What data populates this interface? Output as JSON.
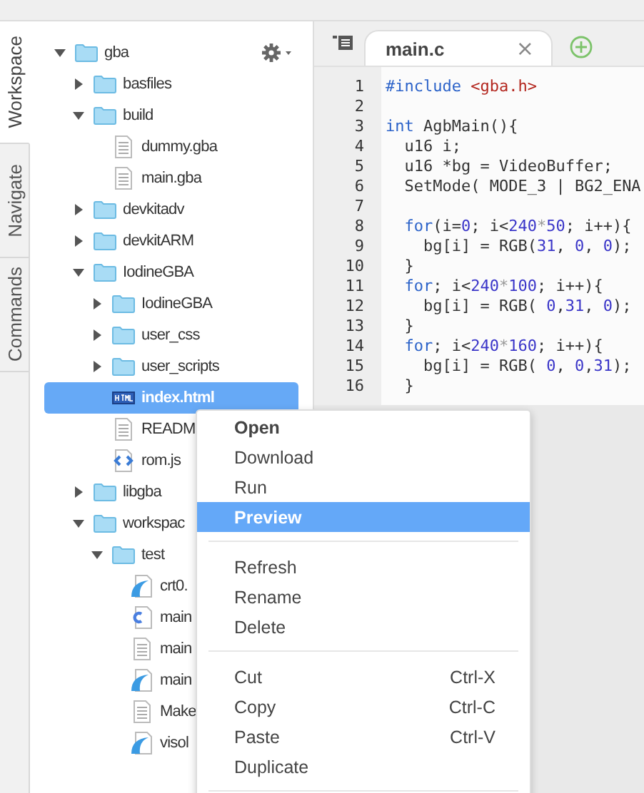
{
  "side_tabs": [
    {
      "label": "Workspace",
      "selected": true
    },
    {
      "label": "Navigate",
      "selected": false
    },
    {
      "label": "Commands",
      "selected": false
    }
  ],
  "tree": [
    {
      "name": "gba",
      "kind": "folder",
      "expanded": true,
      "selected": false,
      "children": [
        {
          "name": "basfiles",
          "kind": "folder",
          "expanded": false,
          "selected": false
        },
        {
          "name": "build",
          "kind": "folder",
          "expanded": true,
          "selected": false,
          "children": [
            {
              "name": "dummy.gba",
              "kind": "file",
              "selected": false
            },
            {
              "name": "main.gba",
              "kind": "file",
              "selected": false
            }
          ]
        },
        {
          "name": "devkitadv",
          "kind": "folder",
          "expanded": false,
          "selected": false
        },
        {
          "name": "devkitARM",
          "kind": "folder",
          "expanded": false,
          "selected": false
        },
        {
          "name": "IodineGBA",
          "kind": "folder",
          "expanded": true,
          "selected": false,
          "children": [
            {
              "name": "IodineGBA",
              "kind": "folder",
              "expanded": false,
              "selected": false
            },
            {
              "name": "user_css",
              "kind": "folder",
              "expanded": false,
              "selected": false
            },
            {
              "name": "user_scripts",
              "kind": "folder",
              "expanded": false,
              "selected": false
            },
            {
              "name": "index.html",
              "kind": "html",
              "selected": true
            },
            {
              "name": "READM",
              "kind": "file",
              "selected": false
            },
            {
              "name": "rom.js",
              "kind": "json",
              "selected": false
            }
          ]
        },
        {
          "name": "libgba",
          "kind": "folder",
          "expanded": false,
          "selected": false
        },
        {
          "name": "workspac",
          "kind": "folder",
          "expanded": true,
          "selected": false,
          "children": [
            {
              "name": "test",
              "kind": "folder",
              "expanded": true,
              "selected": false,
              "children": [
                {
                  "name": "crt0.",
                  "kind": "asm",
                  "selected": false
                },
                {
                  "name": "main",
                  "kind": "c",
                  "selected": false
                },
                {
                  "name": "main",
                  "kind": "file",
                  "selected": false
                },
                {
                  "name": "main",
                  "kind": "asm",
                  "selected": false
                },
                {
                  "name": "Make",
                  "kind": "file",
                  "selected": false
                },
                {
                  "name": "visol",
                  "kind": "asm",
                  "selected": false
                }
              ]
            }
          ]
        }
      ]
    }
  ],
  "editor": {
    "tab": {
      "title": "main.c",
      "close": "×"
    },
    "lines": [
      {
        "n": "1",
        "tokens": [
          {
            "kind": "kw",
            "t": "#include "
          },
          {
            "kind": "str",
            "t": "<gba.h>"
          }
        ]
      },
      {
        "n": "2"
      },
      {
        "n": "3",
        "tokens": [
          {
            "kind": "kw",
            "t": "int"
          },
          {
            "kind": "plain",
            "t": " AgbMain(){"
          }
        ]
      },
      {
        "n": "4",
        "tokens": [
          {
            "kind": "plain",
            "t": "  u16 i;"
          }
        ]
      },
      {
        "n": "5",
        "tokens": [
          {
            "kind": "plain",
            "t": "  u16 *bg = VideoBuffer;"
          }
        ]
      },
      {
        "n": "6",
        "tokens": [
          {
            "kind": "plain",
            "t": "  SetMode( MODE_3 | BG2_ENA"
          }
        ]
      },
      {
        "n": "7"
      },
      {
        "n": "8",
        "tokens": [
          {
            "kind": "kw",
            "t": "  for"
          },
          {
            "kind": "plain",
            "t": "(i="
          },
          {
            "kind": "num",
            "t": "0"
          },
          {
            "kind": "plain",
            "t": "; i<"
          },
          {
            "kind": "num",
            "t": "240"
          },
          {
            "kind": "op",
            "t": "*"
          },
          {
            "kind": "num",
            "t": "50"
          },
          {
            "kind": "plain",
            "t": "; i++){"
          }
        ]
      },
      {
        "n": "9",
        "tokens": [
          {
            "kind": "plain",
            "t": "    bg[i] = RGB("
          },
          {
            "kind": "num",
            "t": "31"
          },
          {
            "kind": "plain",
            "t": ", "
          },
          {
            "kind": "num",
            "t": "0"
          },
          {
            "kind": "plain",
            "t": ", "
          },
          {
            "kind": "num",
            "t": "0"
          },
          {
            "kind": "plain",
            "t": ");"
          }
        ]
      },
      {
        "n": "10",
        "tokens": [
          {
            "kind": "plain",
            "t": "  }"
          }
        ]
      },
      {
        "n": "11",
        "tokens": [
          {
            "kind": "kw",
            "t": "  for"
          },
          {
            "kind": "plain",
            "t": "; i<"
          },
          {
            "kind": "num",
            "t": "240"
          },
          {
            "kind": "op",
            "t": "*"
          },
          {
            "kind": "num",
            "t": "100"
          },
          {
            "kind": "plain",
            "t": "; i++){"
          }
        ]
      },
      {
        "n": "12",
        "tokens": [
          {
            "kind": "plain",
            "t": "    bg[i] = RGB( "
          },
          {
            "kind": "num",
            "t": "0"
          },
          {
            "kind": "plain",
            "t": ","
          },
          {
            "kind": "num",
            "t": "31"
          },
          {
            "kind": "plain",
            "t": ", "
          },
          {
            "kind": "num",
            "t": "0"
          },
          {
            "kind": "plain",
            "t": ");"
          }
        ]
      },
      {
        "n": "13",
        "tokens": [
          {
            "kind": "plain",
            "t": "  }"
          }
        ]
      },
      {
        "n": "14",
        "tokens": [
          {
            "kind": "kw",
            "t": "  for"
          },
          {
            "kind": "plain",
            "t": "; i<"
          },
          {
            "kind": "num",
            "t": "240"
          },
          {
            "kind": "op",
            "t": "*"
          },
          {
            "kind": "num",
            "t": "160"
          },
          {
            "kind": "plain",
            "t": "; i++){"
          }
        ]
      },
      {
        "n": "15",
        "tokens": [
          {
            "kind": "plain",
            "t": "    bg[i] = RGB( "
          },
          {
            "kind": "num",
            "t": "0"
          },
          {
            "kind": "plain",
            "t": ", "
          },
          {
            "kind": "num",
            "t": "0"
          },
          {
            "kind": "plain",
            "t": ","
          },
          {
            "kind": "num",
            "t": "31"
          },
          {
            "kind": "plain",
            "t": ");"
          }
        ]
      },
      {
        "n": "16",
        "tokens": [
          {
            "kind": "plain",
            "t": "  }"
          }
        ]
      }
    ]
  },
  "context_menu": {
    "groups": [
      [
        {
          "label": "Open",
          "default": true,
          "selected": false
        },
        {
          "label": "Download",
          "default": false,
          "selected": false
        },
        {
          "label": "Run",
          "default": false,
          "selected": false
        },
        {
          "label": "Preview",
          "default": false,
          "selected": true
        }
      ],
      [
        {
          "label": "Refresh",
          "default": false,
          "selected": false
        },
        {
          "label": "Rename",
          "default": false,
          "selected": false
        },
        {
          "label": "Delete",
          "default": false,
          "selected": false
        }
      ],
      [
        {
          "label": "Cut",
          "shortcut": "Ctrl-X",
          "default": false,
          "selected": false
        },
        {
          "label": "Copy",
          "shortcut": "Ctrl-C",
          "default": false,
          "selected": false
        },
        {
          "label": "Paste",
          "shortcut": "Ctrl-V",
          "default": false,
          "selected": false
        },
        {
          "label": "Duplicate",
          "default": false,
          "selected": false
        }
      ]
    ]
  }
}
